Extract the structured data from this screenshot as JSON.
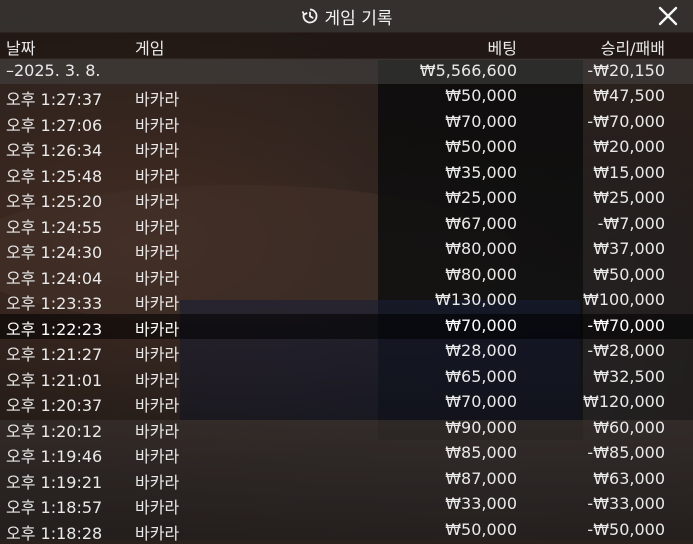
{
  "title": "게임 기록",
  "columns": {
    "date": "날짜",
    "game": "게임",
    "bet": "베팅",
    "result": "승리/패배"
  },
  "summary": {
    "date": "–2025. 3. 8.",
    "bet": "₩5,566,600",
    "result": "-₩20,150"
  },
  "rows": [
    {
      "time": "오후 1:27:37",
      "game": "바카라",
      "bet": "₩50,000",
      "result": "₩47,500"
    },
    {
      "time": "오후 1:27:06",
      "game": "바카라",
      "bet": "₩70,000",
      "result": "-₩70,000"
    },
    {
      "time": "오후 1:26:34",
      "game": "바카라",
      "bet": "₩50,000",
      "result": "₩20,000"
    },
    {
      "time": "오후 1:25:48",
      "game": "바카라",
      "bet": "₩35,000",
      "result": "₩15,000"
    },
    {
      "time": "오후 1:25:20",
      "game": "바카라",
      "bet": "₩25,000",
      "result": "₩25,000"
    },
    {
      "time": "오후 1:24:55",
      "game": "바카라",
      "bet": "₩67,000",
      "result": "-₩7,000"
    },
    {
      "time": "오후 1:24:30",
      "game": "바카라",
      "bet": "₩80,000",
      "result": "₩37,000"
    },
    {
      "time": "오후 1:24:04",
      "game": "바카라",
      "bet": "₩80,000",
      "result": "₩50,000"
    },
    {
      "time": "오후 1:23:33",
      "game": "바카라",
      "bet": "₩130,000",
      "result": "₩100,000"
    },
    {
      "time": "오후 1:22:23",
      "game": "바카라",
      "bet": "₩70,000",
      "result": "-₩70,000"
    },
    {
      "time": "오후 1:21:27",
      "game": "바카라",
      "bet": "₩28,000",
      "result": "-₩28,000"
    },
    {
      "time": "오후 1:21:01",
      "game": "바카라",
      "bet": "₩65,000",
      "result": "₩32,500"
    },
    {
      "time": "오후 1:20:37",
      "game": "바카라",
      "bet": "₩70,000",
      "result": "₩120,000"
    },
    {
      "time": "오후 1:20:12",
      "game": "바카라",
      "bet": "₩90,000",
      "result": "₩60,000"
    },
    {
      "time": "오후 1:19:46",
      "game": "바카라",
      "bet": "₩85,000",
      "result": "-₩85,000"
    },
    {
      "time": "오후 1:19:21",
      "game": "바카라",
      "bet": "₩87,000",
      "result": "₩63,000"
    },
    {
      "time": "오후 1:18:57",
      "game": "바카라",
      "bet": "₩33,000",
      "result": "-₩33,000"
    },
    {
      "time": "오후 1:18:28",
      "game": "바카라",
      "bet": "₩50,000",
      "result": "-₩50,000"
    }
  ],
  "icons": {
    "title": "history-icon",
    "close": "close-icon"
  }
}
